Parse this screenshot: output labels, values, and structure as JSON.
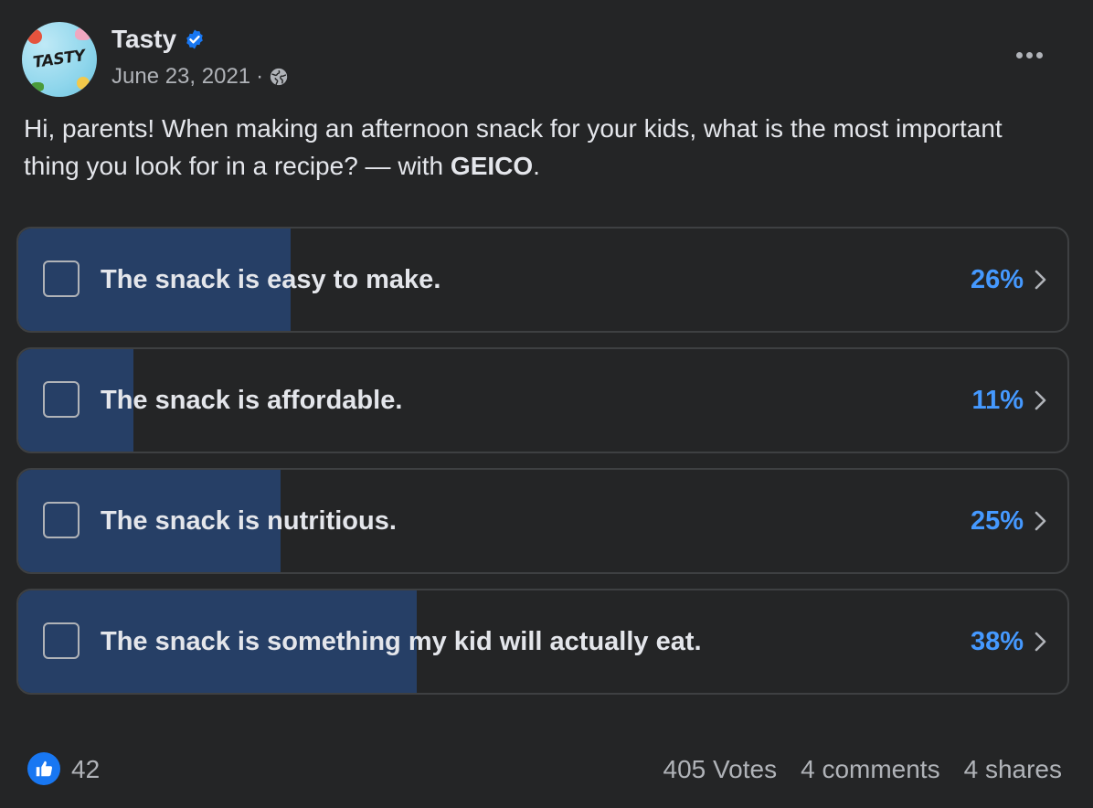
{
  "header": {
    "page_name": "Tasty",
    "avatar_text": "TASTY",
    "date": "June 23, 2021",
    "separator": "·",
    "verified_icon": "verified-badge-icon",
    "audience_icon": "globe-icon",
    "more_icon": "more-dots-icon"
  },
  "post": {
    "text_before": "Hi, parents! When making an afternoon snack for your kids, what is the most important thing you look for in a recipe? — with ",
    "tag": "GEICO",
    "text_after": "."
  },
  "poll": {
    "options": [
      {
        "label": "The snack is easy to make.",
        "percent_label": "26%",
        "fill_fraction": 0.26
      },
      {
        "label": "The snack is affordable.",
        "percent_label": "11%",
        "fill_fraction": 0.11
      },
      {
        "label": "The snack is nutritious.",
        "percent_label": "25%",
        "fill_fraction": 0.25
      },
      {
        "label": "The snack is something my kid will actually eat.",
        "percent_label": "38%",
        "fill_fraction": 0.38
      }
    ]
  },
  "footer": {
    "like_icon": "thumbs-up-icon",
    "like_count": "42",
    "votes": "405 Votes",
    "comments": "4 comments",
    "shares": "4 shares"
  },
  "colors": {
    "background": "#242526",
    "accent": "#4599ff",
    "poll_fill": "#263f66",
    "like_blue": "#1877f2"
  }
}
